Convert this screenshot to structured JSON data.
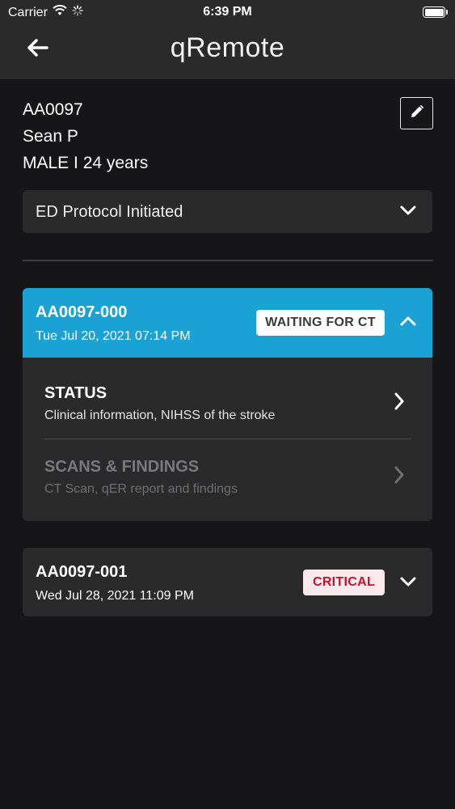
{
  "status_bar": {
    "carrier": "Carrier",
    "time": "6:39 PM"
  },
  "header": {
    "title": "qRemote",
    "back_icon": "arrow-left-icon"
  },
  "patient": {
    "id": "AA0097",
    "name": "Sean P",
    "meta": "MALE I 24 years",
    "edit_icon": "pencil-icon"
  },
  "protocol": {
    "label": "ED Protocol Initiated"
  },
  "cases": [
    {
      "id": "AA0097-000",
      "date": "Tue Jul 20, 2021 07:14 PM",
      "badge": "WAITING FOR CT",
      "expanded": true,
      "header_color": "#1aa2d4",
      "sections": [
        {
          "title": "STATUS",
          "subtitle": "Clinical information, NIHSS of the stroke",
          "enabled": true
        },
        {
          "title": "SCANS & FINDINGS",
          "subtitle": "CT Scan, qER report and findings",
          "enabled": false
        }
      ]
    },
    {
      "id": "AA0097-001",
      "date": "Wed Jul 28, 2021 11:09 PM",
      "badge": "CRITICAL",
      "badge_color": "#c8102e",
      "expanded": false
    }
  ]
}
